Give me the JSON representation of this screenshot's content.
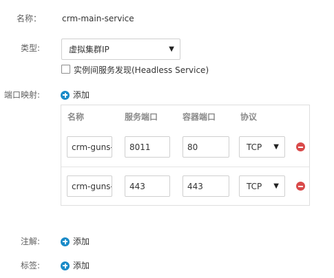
{
  "form": {
    "name_label": "名称：",
    "name_value": "crm-main-service",
    "type_label": "类型:",
    "type_selected": "虚拟集群IP",
    "headless_label": "实例间服务发现(Headless Service)",
    "headless_checked": false,
    "port_mapping_label": "端口映射:",
    "add_label": "添加",
    "annotations_label": "注解:",
    "tags_label": "标签:"
  },
  "ports": {
    "headers": {
      "name": "名称",
      "service_port": "服务端口",
      "container_port": "容器端口",
      "protocol": "协议"
    },
    "rows": [
      {
        "name": "crm-guns-",
        "service_port": "8011",
        "container_port": "80",
        "protocol": "TCP"
      },
      {
        "name": "crm-guns-",
        "service_port": "443",
        "container_port": "443",
        "protocol": "TCP"
      }
    ]
  },
  "colors": {
    "accent": "#1a8bc8",
    "danger": "#d94a4a",
    "border": "#dedede"
  },
  "icons": {
    "add": "plus-circle-icon",
    "remove": "minus-circle-icon",
    "dropdown": "caret-down-icon"
  }
}
